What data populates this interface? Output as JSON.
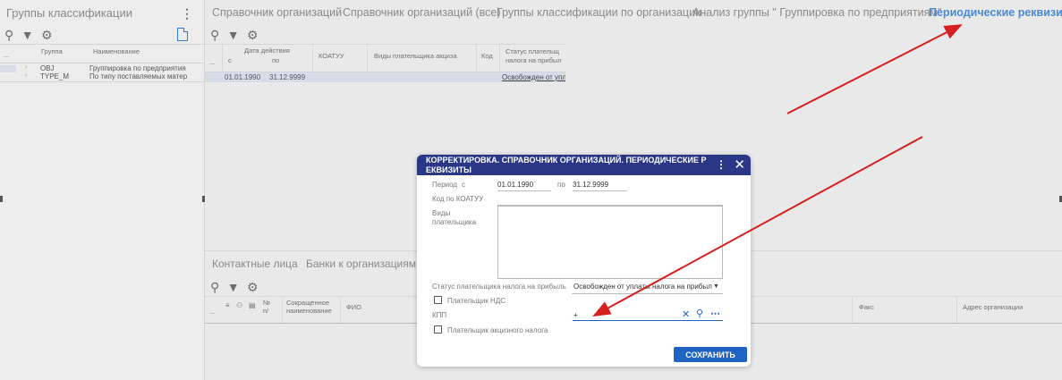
{
  "left_panel": {
    "title": "Группы классификации",
    "columns": [
      "...",
      "Группа",
      "Наименование"
    ],
    "rows": [
      {
        "code": "OBJ",
        "name": "Группировка по предприятия"
      },
      {
        "code": "TYPE_M",
        "name": "По типу поставляемых матер"
      }
    ]
  },
  "top_tabs": [
    "Справочник организаций",
    "Справочник организаций (все)",
    "Группы классификации по организации",
    "Анализ группы \" Группировка по предприятиям\"",
    "Периодические реквизиты"
  ],
  "main_grid": {
    "columns": {
      "dots": "...",
      "date_range": "Дата действия",
      "from": "с",
      "to": "по",
      "koatuu": "КОАТУУ",
      "payer_types": "Виды плательщика акциза",
      "code": "Код",
      "status_line1": "Статус плательщ",
      "status_line2": "налога на прибыл"
    },
    "row": {
      "from": "01.01.1990",
      "to": "31.12.9999",
      "status": "Освобожден от упл"
    }
  },
  "bottom_tabs": [
    "Контактные лица",
    "Банки к организациям"
  ],
  "bottom_grid": {
    "dots": "...",
    "num_line1": "№",
    "num_line2": "п/",
    "short_name_line1": "Сокращенное",
    "short_name_line2": "наименование",
    "fio": "ФИО",
    "fax": "Факс",
    "address": "Адрес организации"
  },
  "dialog": {
    "title": "КОРРЕКТИРОВКА. СПРАВОЧНИК ОРГАНИЗАЦИЙ. ПЕРИОДИЧЕСКИЕ Р ЕКВИЗИТЫ",
    "period_label": "Период",
    "from_label": "с",
    "from_value": "01.01.1990",
    "to_label": "по",
    "to_value": "31.12.9999",
    "koatuu_label": "Код по КОАТУУ",
    "payer_types_label_1": "Виды",
    "payer_types_label_2": "плательщика",
    "profit_status_label": "Статус плательщика налога на прибыль",
    "profit_status_value": "Освобожден от уплаты налога на прибыль",
    "vat_payer_label": "Плательщик НДС",
    "kpp_label": "КПП",
    "kpp_value": "+",
    "excise_payer_label": "Плательщик акцизного налога",
    "save_label": "СОХРАНИТЬ"
  },
  "colors": {
    "dialog_header": "#2a3787",
    "active_tab": "#4b8ad6",
    "save_button": "#1f63c3",
    "arrow": "#d81f1f"
  }
}
